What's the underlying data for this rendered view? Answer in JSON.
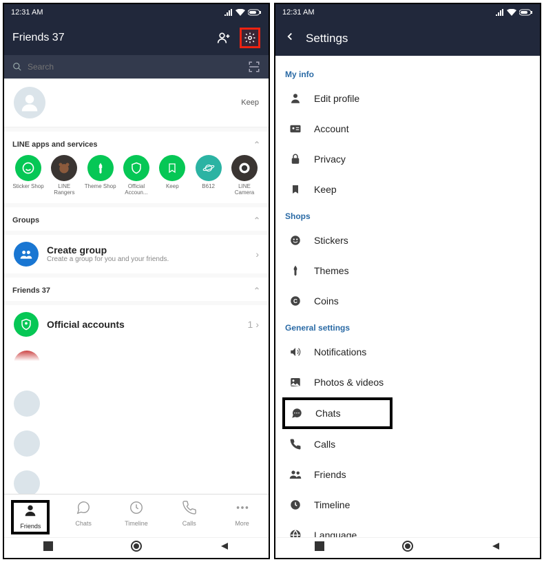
{
  "statusbar": {
    "time": "12:31 AM"
  },
  "left": {
    "header_title": "Friends 37",
    "search_placeholder": "Search",
    "keep": "Keep",
    "apps_section": "LINE apps and services",
    "apps": [
      {
        "label": "Sticker Shop"
      },
      {
        "label": "LINE Rangers"
      },
      {
        "label": "Theme Shop"
      },
      {
        "label": "Official Accoun..."
      },
      {
        "label": "Keep"
      },
      {
        "label": "B612"
      },
      {
        "label": "LINE Camera"
      }
    ],
    "groups_header": "Groups",
    "create_group": {
      "title": "Create group",
      "sub": "Create a group for you and your friends."
    },
    "friends_header": "Friends 37",
    "official": {
      "title": "Official accounts",
      "count": "1"
    },
    "nav": {
      "friends": "Friends",
      "chats": "Chats",
      "timeline": "Timeline",
      "calls": "Calls",
      "more": "More"
    }
  },
  "right": {
    "title": "Settings",
    "myinfo": "My info",
    "shops": "Shops",
    "general": "General settings",
    "items": {
      "edit_profile": "Edit profile",
      "account": "Account",
      "privacy": "Privacy",
      "keep": "Keep",
      "stickers": "Stickers",
      "themes": "Themes",
      "coins": "Coins",
      "notifications": "Notifications",
      "photos": "Photos & videos",
      "chats": "Chats",
      "calls": "Calls",
      "friends": "Friends",
      "timeline": "Timeline",
      "language": "Language"
    }
  }
}
